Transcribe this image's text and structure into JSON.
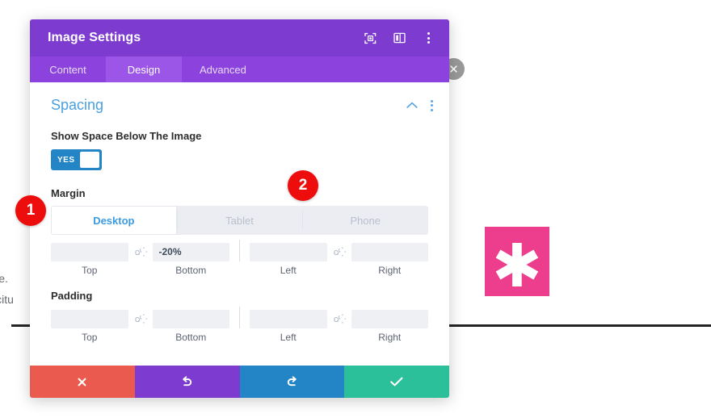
{
  "background": {
    "text_lines": [
      "here.",
      "ollicitu"
    ],
    "image_block": {
      "glyph": "✱",
      "color": "#ec3e8c",
      "name": "asterisk-image"
    },
    "close_button_icon": "close-circle-icon",
    "divider": true
  },
  "modal": {
    "title": "Image Settings",
    "header_icons": [
      {
        "name": "focus-target-icon"
      },
      {
        "name": "layout-panel-icon"
      },
      {
        "name": "more-vertical-icon"
      }
    ],
    "tabs": [
      {
        "label": "Content",
        "active": false
      },
      {
        "label": "Design",
        "active": true
      },
      {
        "label": "Advanced",
        "active": false
      }
    ],
    "section": {
      "title": "Spacing",
      "collapse_icon": "chevron-up-icon",
      "menu_icon": "more-vertical-icon"
    },
    "toggle_field": {
      "label": "Show Space Below The Image",
      "value": "YES",
      "state": true
    },
    "margin": {
      "label": "Margin",
      "devices": [
        {
          "label": "Desktop",
          "active": true
        },
        {
          "label": "Tablet",
          "active": false
        },
        {
          "label": "Phone",
          "active": false
        }
      ],
      "fields": [
        {
          "label": "Top",
          "value": ""
        },
        {
          "label": "Bottom",
          "value": "-20%"
        },
        {
          "label": "Left",
          "value": ""
        },
        {
          "label": "Right",
          "value": ""
        }
      ],
      "link_icon": "link-chain-icon"
    },
    "padding": {
      "label": "Padding",
      "fields": [
        {
          "label": "Top",
          "value": ""
        },
        {
          "label": "Bottom",
          "value": ""
        },
        {
          "label": "Left",
          "value": ""
        },
        {
          "label": "Right",
          "value": ""
        }
      ],
      "link_icon": "link-chain-icon"
    },
    "footer_buttons": [
      {
        "name": "cancel-button",
        "icon": "close-x-icon",
        "color": "#eb5a4e"
      },
      {
        "name": "undo-button",
        "icon": "undo-arrow-icon",
        "color": "#7e3bd0"
      },
      {
        "name": "redo-button",
        "icon": "redo-arrow-icon",
        "color": "#2384c6"
      },
      {
        "name": "save-button",
        "icon": "checkmark-icon",
        "color": "#2bbf9a"
      }
    ]
  },
  "callouts": [
    {
      "number": "1"
    },
    {
      "number": "2"
    }
  ]
}
